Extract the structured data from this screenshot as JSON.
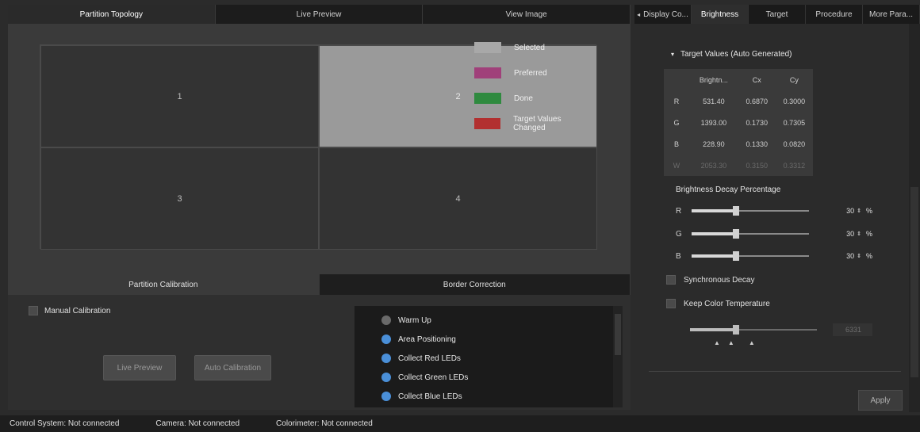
{
  "top_tabs": [
    "Partition Topology",
    "Live Preview",
    "View Image"
  ],
  "cells": [
    "1",
    "2",
    "3",
    "4"
  ],
  "legend": [
    {
      "label": "Selected",
      "color": "#a8a8a8"
    },
    {
      "label": "Preferred",
      "color": "#a0407a"
    },
    {
      "label": "Done",
      "color": "#2f8a3f"
    },
    {
      "label": "Target Values Changed",
      "color": "#b23030"
    }
  ],
  "bottom_tabs": [
    "Partition Calibration",
    "Border Correction"
  ],
  "manual_calibration_label": "Manual Calibration",
  "buttons": {
    "live_preview": "Live Preview",
    "auto_calibration": "Auto Calibration"
  },
  "procedure": [
    {
      "label": "Warm Up",
      "state": "gray"
    },
    {
      "label": "Area Positioning",
      "state": "blue"
    },
    {
      "label": "Collect Red LEDs",
      "state": "blue"
    },
    {
      "label": "Collect Green LEDs",
      "state": "blue"
    },
    {
      "label": "Collect Blue LEDs",
      "state": "blue"
    }
  ],
  "status": {
    "control_system": "Control System: Not connected",
    "camera": "Camera: Not connected",
    "colorimeter": "Colorimeter: Not connected"
  },
  "right_tabs": [
    "Display Co...",
    "Brightness",
    "Target",
    "Procedure",
    "More Para..."
  ],
  "target_values": {
    "header": "Target Values (Auto Generated)",
    "columns": [
      "Brightn...",
      "Cx",
      "Cy"
    ],
    "rows": [
      {
        "label": "R",
        "values": [
          "531.40",
          "0.6870",
          "0.3000"
        ]
      },
      {
        "label": "G",
        "values": [
          "1393.00",
          "0.1730",
          "0.7305"
        ]
      },
      {
        "label": "B",
        "values": [
          "228.90",
          "0.1330",
          "0.0820"
        ]
      },
      {
        "label": "W",
        "values": [
          "2053.30",
          "0.3150",
          "0.3312"
        ]
      }
    ]
  },
  "brightness_decay": {
    "label": "Brightness Decay Percentage",
    "channels": [
      {
        "label": "R",
        "value": "30",
        "fraction": 0.38
      },
      {
        "label": "G",
        "value": "30",
        "fraction": 0.38
      },
      {
        "label": "B",
        "value": "30",
        "fraction": 0.38
      }
    ],
    "unit": "%"
  },
  "synchronous_decay": "Synchronous Decay",
  "keep_color_temp": "Keep Color Temperature",
  "color_temp_value": "6331",
  "color_temp_fraction": 0.36,
  "apply_label": "Apply"
}
